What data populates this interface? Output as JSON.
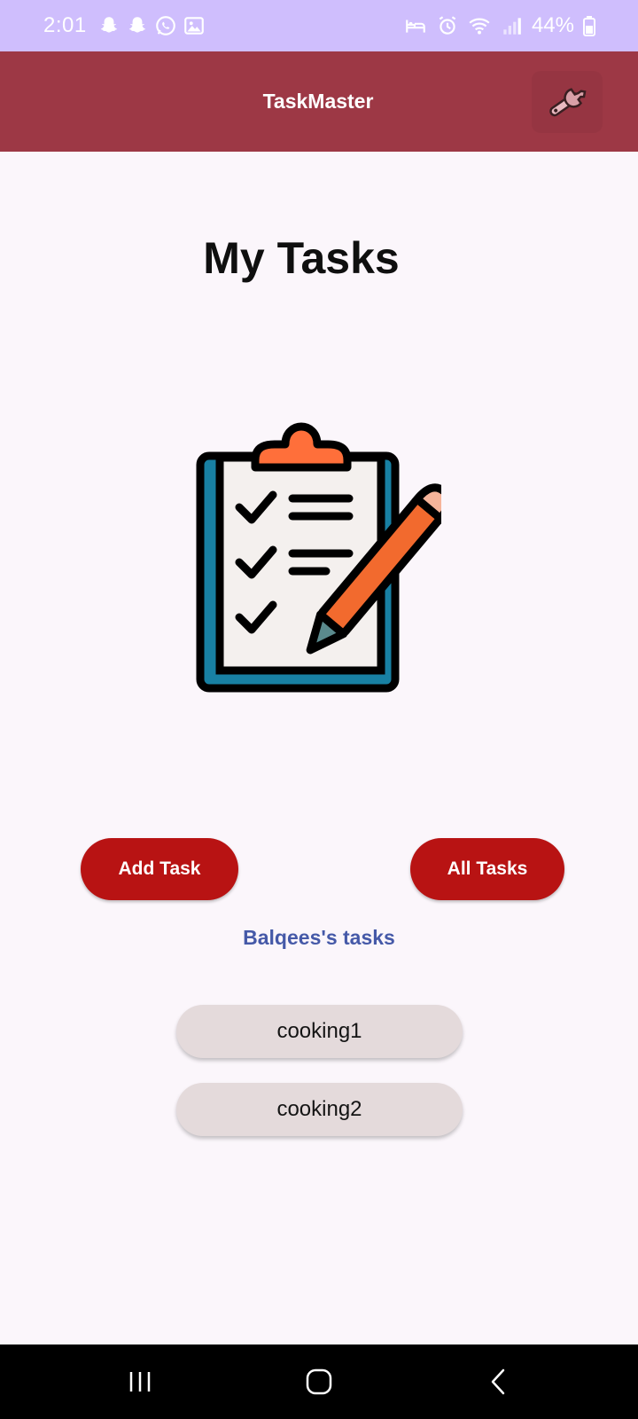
{
  "status_bar": {
    "time": "2:01",
    "battery": "44%",
    "left_icons": [
      "snapchat-icon",
      "snapchat-icon",
      "whatsapp-icon",
      "gallery-icon"
    ],
    "right_icons": [
      "bed-icon",
      "alarm-icon",
      "wifi-icon",
      "signal-icon",
      "battery-icon"
    ]
  },
  "app_bar": {
    "title": "TaskMaster",
    "settings_icon": "wrench-icon"
  },
  "main": {
    "page_title": "My Tasks",
    "hero_icon": "clipboard-checklist-icon",
    "add_task_label": "Add Task",
    "all_tasks_label": "All Tasks",
    "user_tasks_label": "Balqees's tasks",
    "tasks": [
      "cooking1",
      "cooking2"
    ]
  },
  "nav_bar": {
    "icons": [
      "recent-apps-icon",
      "home-icon",
      "back-icon"
    ]
  },
  "colors": {
    "status_bar": "#cfbefd",
    "app_bar": "#9d3845",
    "background": "#fbf6fb",
    "button_red": "#b81313",
    "label_blue": "#4559a8",
    "task_pill": "#e4dadb"
  }
}
